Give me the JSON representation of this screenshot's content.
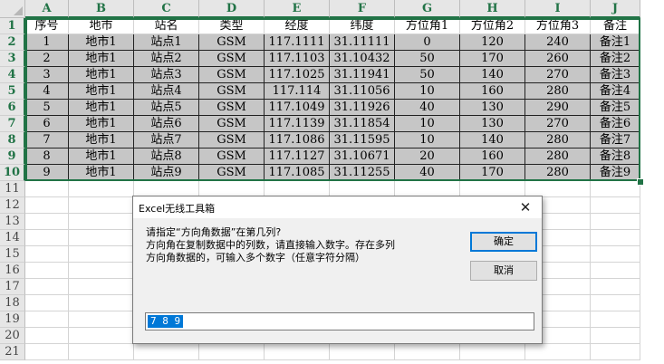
{
  "sheet": {
    "columns": [
      "A",
      "B",
      "C",
      "D",
      "E",
      "F",
      "G",
      "H",
      "I",
      "J"
    ],
    "row_numbers": [
      "1",
      "2",
      "3",
      "4",
      "5",
      "6",
      "7",
      "8",
      "9",
      "10",
      "11",
      "12",
      "13",
      "14",
      "15",
      "16",
      "17",
      "18",
      "19",
      "20",
      "21"
    ],
    "header_row": [
      "序号",
      "地市",
      "站名",
      "类型",
      "经度",
      "纬度",
      "方位角1",
      "方位角2",
      "方位角3",
      "备注"
    ],
    "data_rows": [
      [
        "1",
        "地市1",
        "站点1",
        "GSM",
        "117.1111",
        "31.11111",
        "0",
        "120",
        "240",
        "备注1"
      ],
      [
        "2",
        "地市1",
        "站点2",
        "GSM",
        "117.1103",
        "31.10432",
        "50",
        "170",
        "260",
        "备注2"
      ],
      [
        "3",
        "地市1",
        "站点3",
        "GSM",
        "117.1025",
        "31.11941",
        "50",
        "140",
        "270",
        "备注3"
      ],
      [
        "4",
        "地市1",
        "站点4",
        "GSM",
        "117.114",
        "31.11056",
        "10",
        "160",
        "280",
        "备注4"
      ],
      [
        "5",
        "地市1",
        "站点5",
        "GSM",
        "117.1049",
        "31.11926",
        "40",
        "130",
        "290",
        "备注5"
      ],
      [
        "6",
        "地市1",
        "站点6",
        "GSM",
        "117.1139",
        "31.11854",
        "10",
        "130",
        "270",
        "备注6"
      ],
      [
        "7",
        "地市1",
        "站点7",
        "GSM",
        "117.1086",
        "31.11595",
        "10",
        "140",
        "280",
        "备注7"
      ],
      [
        "8",
        "地市1",
        "站点8",
        "GSM",
        "117.1127",
        "31.10671",
        "20",
        "160",
        "280",
        "备注8"
      ],
      [
        "9",
        "地市1",
        "站点9",
        "GSM",
        "117.1085",
        "31.11255",
        "40",
        "170",
        "280",
        "备注9"
      ]
    ],
    "accent_color": "#217346",
    "selection_fill": "#c6c6c6"
  },
  "dialog": {
    "title": "Excel无线工具箱",
    "close_icon": "close-icon",
    "message_lines": [
      "请指定“方向角数据”在第几列?",
      "方向角在复制数据中的列数，请直接输入数字。存在多列",
      "方向角数据的，可输入多个数字（任意字符分隔）"
    ],
    "ok_label": "确定",
    "cancel_label": "取消",
    "input_value": "7 8 9",
    "selection_color": "#0078d7"
  }
}
